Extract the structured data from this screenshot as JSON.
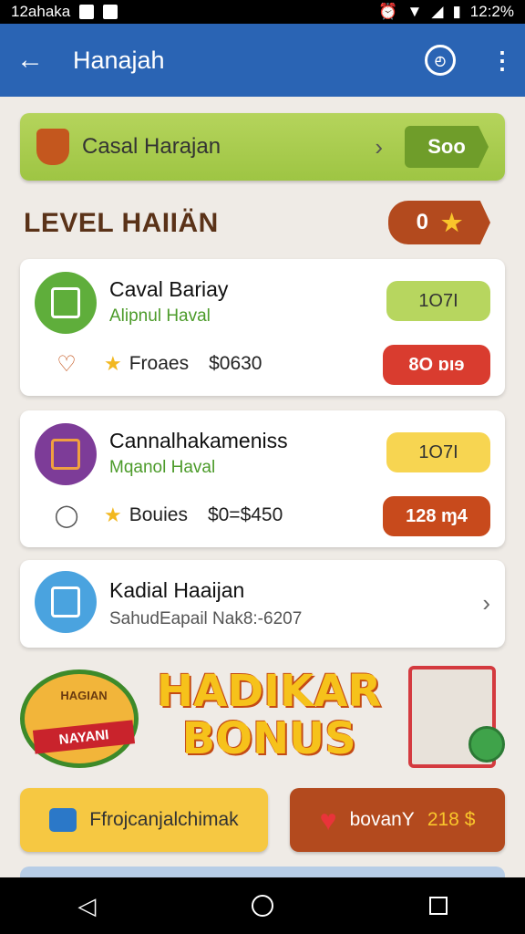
{
  "status_bar": {
    "left_text": "12ahaka",
    "time": "12:2%"
  },
  "app_bar": {
    "title": "Hanajah",
    "back_icon": "←",
    "more_icon": "⋮"
  },
  "banner": {
    "label": "Casal Harajan",
    "chevron": "›",
    "pill": "Soo"
  },
  "section": {
    "title": "LEVEL HAIIÄN",
    "badge_value": "0"
  },
  "cards": [
    {
      "name": "Caval Bariay",
      "sub": "Alipnul Haval",
      "top_pill": "1O7I",
      "row_label": "Froaes",
      "row_value": "$0630",
      "bottom_pill": "8O ɒıɘ",
      "colors": {
        "avatar": "#5fae3b",
        "sub": "#4c9b2a",
        "top_pill": "#b7d65f",
        "bottom_pill": "#d93c2f"
      }
    },
    {
      "name": "Cannalhakameniss",
      "sub": "Mqanol Haval",
      "top_pill": "1O7I",
      "row_label": "Bouies",
      "row_value": "$0=$450",
      "bottom_pill": "128 ɱ4",
      "colors": {
        "avatar": "#7d3c98",
        "sub": "#4c9b2a",
        "top_pill": "#f7d551",
        "bottom_pill": "#c84a1c"
      }
    },
    {
      "name": "Kadial Haaijan",
      "sub": "SahudEapail Nak8:-6207",
      "chevron": "›",
      "colors": {
        "avatar": "#4aa3df"
      }
    }
  ],
  "promo": {
    "headline_1": "HADIKAR",
    "headline_2": "BONUS",
    "emblem_top": "HAGIAN",
    "emblem_ribbon": "NAYANI"
  },
  "buttons": {
    "left_label": "Ffrojcanjalchimak",
    "right_label": "bovanY",
    "right_amount": "218 $"
  },
  "icons": {
    "star": "★",
    "heart": "♥",
    "chevron": "›"
  }
}
